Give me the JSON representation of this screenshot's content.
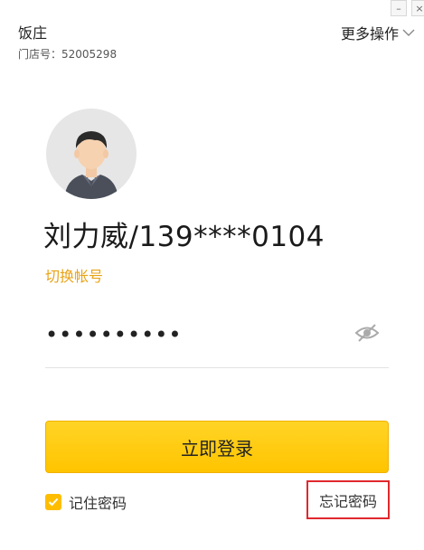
{
  "window": {
    "minimize_label": "–",
    "close_label": "×"
  },
  "store": {
    "name": "饭庄",
    "id_label": "门店号：52005298"
  },
  "menu": {
    "more_ops_label": "更多操作"
  },
  "user": {
    "display": "刘力威/139****0104"
  },
  "account": {
    "switch_label": "切换帐号"
  },
  "password": {
    "value": "••••••••••"
  },
  "actions": {
    "login_label": "立即登录",
    "remember_label": "记住密码",
    "remember_checked": true,
    "forgot_label": "忘记密码"
  },
  "colors": {
    "accent": "#ffc400",
    "link": "#e8a317",
    "highlight_border": "#e0282e"
  }
}
